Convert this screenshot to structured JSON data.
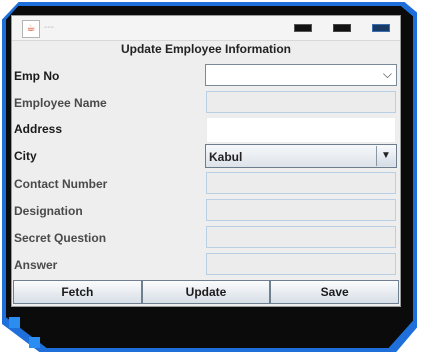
{
  "window": {
    "title": "---"
  },
  "form": {
    "title": "Update Employee Information",
    "fields": [
      {
        "label": "Emp No",
        "type": "combo",
        "value": ""
      },
      {
        "label": "Employee Name",
        "type": "text",
        "value": ""
      },
      {
        "label": "Address",
        "type": "text",
        "value": ""
      },
      {
        "label": "City",
        "type": "select",
        "value": "Kabul"
      },
      {
        "label": "Contact Number",
        "type": "text",
        "value": ""
      },
      {
        "label": "Designation",
        "type": "text",
        "value": ""
      },
      {
        "label": "Secret Question",
        "type": "text",
        "value": ""
      },
      {
        "label": "Answer",
        "type": "text",
        "value": ""
      }
    ]
  },
  "buttons": {
    "fetch": "Fetch",
    "update": "Update",
    "save": "Save"
  },
  "icons": {
    "dropdown_arrow": "chevron-down-icon",
    "select_arrow": "triangle-down-icon"
  },
  "colors": {
    "frame_accent": "#1e6fd9",
    "frame_background": "#0b0b0b"
  }
}
